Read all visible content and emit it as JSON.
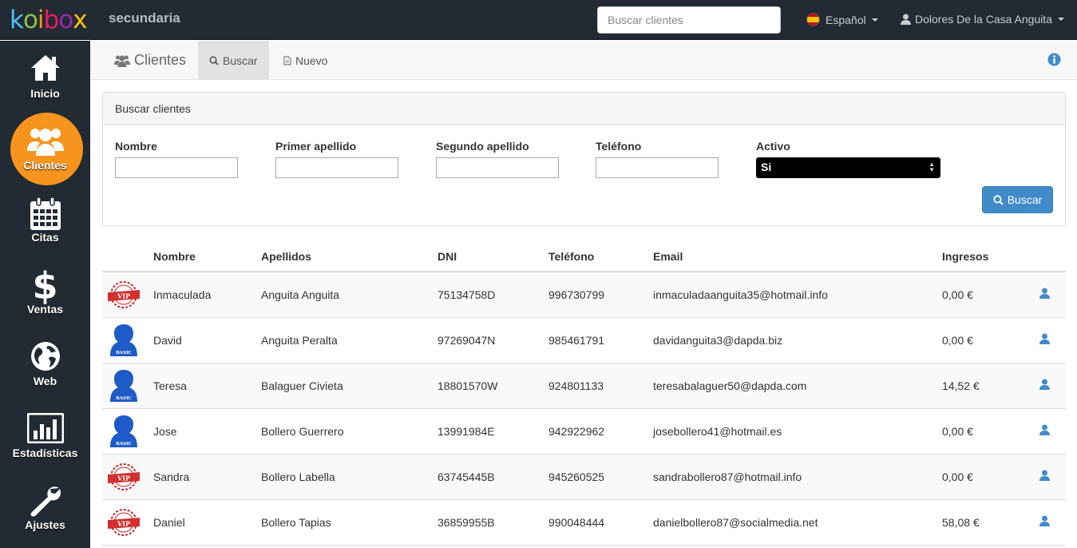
{
  "app": {
    "logo": "koibox",
    "brand": "secundaria",
    "search_placeholder": "Buscar clientes",
    "language": "Español",
    "user_name": "Dolores De la Casa Anguita"
  },
  "colors": {
    "accent": "#f7941d",
    "primary": "#428bca",
    "sidebar": "#222a33"
  },
  "sidebar": {
    "items": [
      {
        "label": "Inicio",
        "icon": "home-icon"
      },
      {
        "label": "Clientes",
        "icon": "users-icon",
        "active": true
      },
      {
        "label": "Citas",
        "icon": "calendar-icon"
      },
      {
        "label": "Ventas",
        "icon": "dollar-icon"
      },
      {
        "label": "Web",
        "icon": "globe-icon"
      },
      {
        "label": "Estadísticas",
        "icon": "bar-chart-icon"
      },
      {
        "label": "Ajustes",
        "icon": "wrench-icon"
      }
    ]
  },
  "subheader": {
    "title": "Clientes",
    "tabs": [
      {
        "label": "Buscar",
        "active": true
      },
      {
        "label": "Nuevo",
        "active": false
      }
    ]
  },
  "search_panel": {
    "title": "Buscar clientes",
    "fields": [
      {
        "label": "Nombre",
        "value": ""
      },
      {
        "label": "Primer apellido",
        "value": ""
      },
      {
        "label": "Segundo apellido",
        "value": ""
      },
      {
        "label": "Teléfono",
        "value": ""
      }
    ],
    "active_label": "Activo",
    "active_value": "Si",
    "button": "Buscar"
  },
  "table": {
    "headers": [
      "Nombre",
      "Apellidos",
      "DNI",
      "Teléfono",
      "Email",
      "Ingresos"
    ],
    "rows": [
      {
        "badge": "VIP",
        "nombre": "Inmaculada",
        "apellidos": "Anguita Anguita",
        "dni": "75134758D",
        "telefono": "996730799",
        "email": "inmaculadaanguita35@hotmail.info",
        "ingresos": "0,00 €"
      },
      {
        "badge": "BASIC",
        "nombre": "David",
        "apellidos": "Anguita Peralta",
        "dni": "97269047N",
        "telefono": "985461791",
        "email": "davidanguita3@dapda.biz",
        "ingresos": "0,00 €"
      },
      {
        "badge": "BASIC",
        "nombre": "Teresa",
        "apellidos": "Balaguer Civieta",
        "dni": "18801570W",
        "telefono": "924801133",
        "email": "teresabalaguer50@dapda.com",
        "ingresos": "14,52 €"
      },
      {
        "badge": "BASIC",
        "nombre": "Jose",
        "apellidos": "Bollero Guerrero",
        "dni": "13991984E",
        "telefono": "942922962",
        "email": "josebollero41@hotmail.es",
        "ingresos": "0,00 €"
      },
      {
        "badge": "VIP",
        "nombre": "Sandra",
        "apellidos": "Bollero Labella",
        "dni": "63745445B",
        "telefono": "945260525",
        "email": "sandrabollero87@hotmail.info",
        "ingresos": "0,00 €"
      },
      {
        "badge": "VIP",
        "nombre": "Daniel",
        "apellidos": "Bollero Tapias",
        "dni": "36859955B",
        "telefono": "990048444",
        "email": "danielbollero87@socialmedia.net",
        "ingresos": "58,08 €"
      }
    ]
  }
}
